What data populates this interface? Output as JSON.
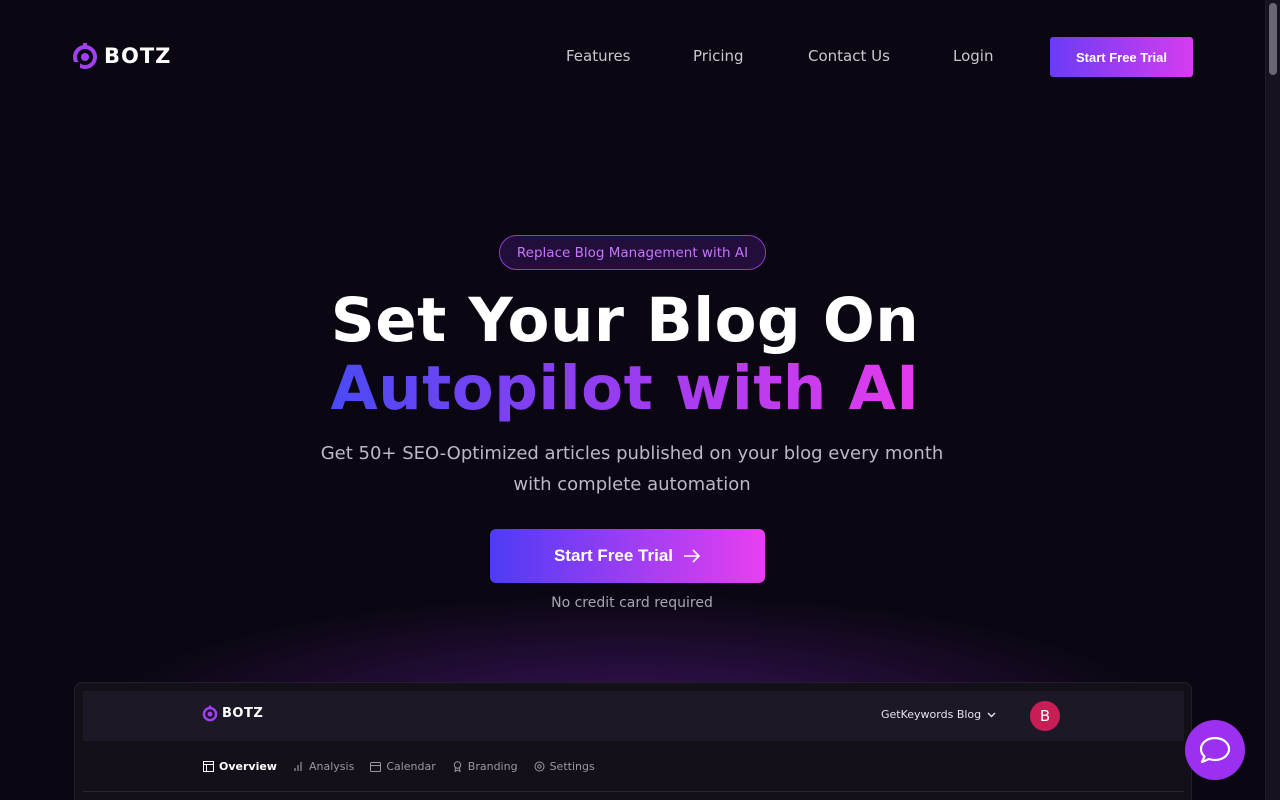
{
  "nav": {
    "logo_text": "BOTZ",
    "links": [
      "Features",
      "Pricing",
      "Contact Us",
      "Login"
    ],
    "cta_label": "Start Free Trial"
  },
  "hero": {
    "badge": "Replace Blog Management with AI",
    "headline_line1": "Set Your Blog On",
    "headline_line2": "Autopilot with AI",
    "subhead_line1": "Get 50+ SEO-Optimized articles published on your blog every month",
    "subhead_line2": "with complete automation",
    "cta_label": "Start Free Trial",
    "note": "No credit card required"
  },
  "preview": {
    "logo_text": "BOTZ",
    "blog_selector": "GetKeywords Blog",
    "avatar_initial": "B",
    "tabs": [
      {
        "label": "Overview",
        "icon": "layout-icon",
        "active": true
      },
      {
        "label": "Analysis",
        "icon": "bar-chart-icon",
        "active": false
      },
      {
        "label": "Calendar",
        "icon": "calendar-icon",
        "active": false
      },
      {
        "label": "Branding",
        "icon": "award-icon",
        "active": false
      },
      {
        "label": "Settings",
        "icon": "gear-icon",
        "active": false
      }
    ]
  },
  "colors": {
    "background": "#0b0712",
    "gradient_start": "#4e3cf5",
    "gradient_end": "#e83ff0",
    "badge_text": "#c873ff",
    "chat_button": "#9b30f0",
    "avatar": "#c81d55"
  },
  "chat": {
    "icon": "chat-bubble-icon"
  }
}
